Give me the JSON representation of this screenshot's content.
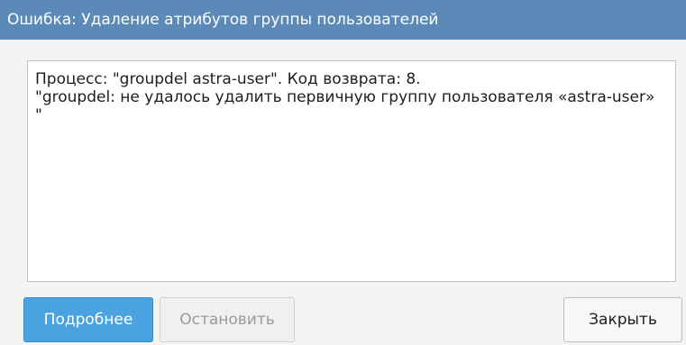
{
  "window": {
    "title": "Ошибка: Удаление атрибутов группы пользователей"
  },
  "message": {
    "lines": [
      "Процесс: \"groupdel astra-user\". Код возврата: 8.",
      "\"groupdel: не удалось удалить первичную группу пользователя «astra-user»",
      "\""
    ]
  },
  "buttons": {
    "details_label": "Подробнее",
    "stop_label": "Остановить",
    "close_label": "Закрыть"
  },
  "colors": {
    "titlebar": "#5c8ab8",
    "primary_button": "#4aa3df"
  }
}
